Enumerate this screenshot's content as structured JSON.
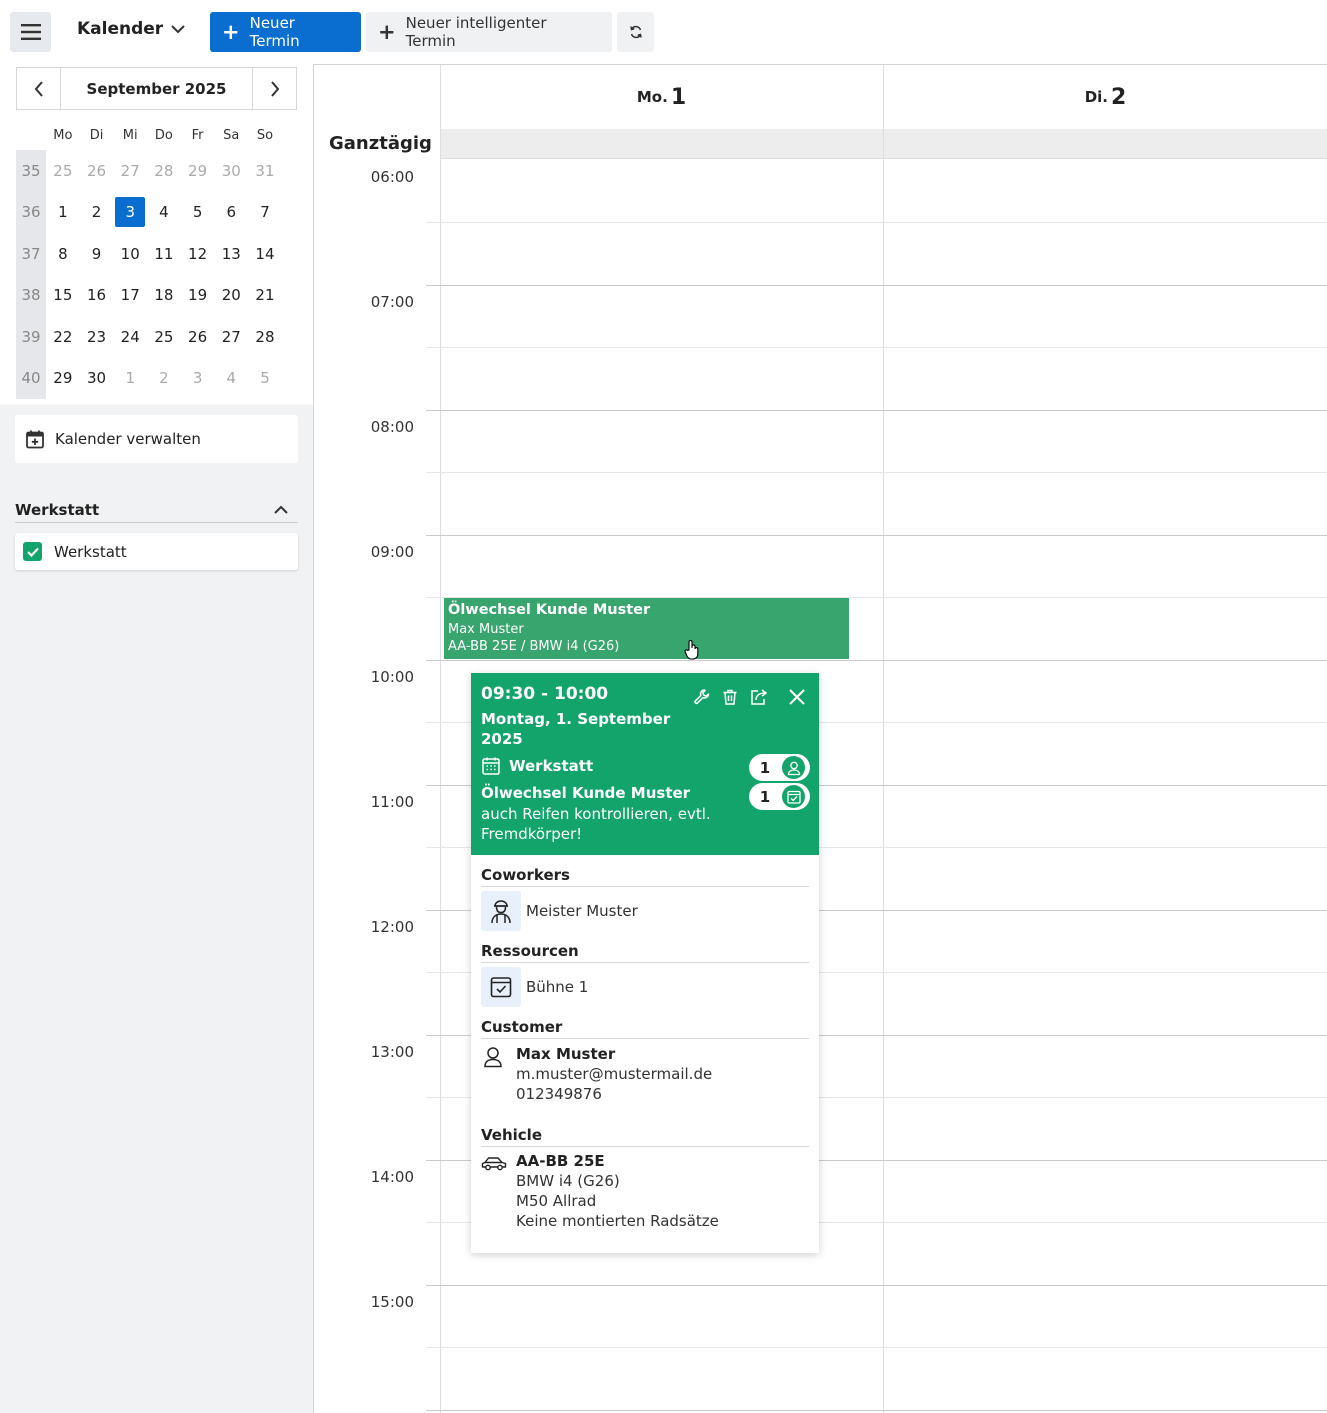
{
  "topbar": {
    "calendar_title": "Kalender",
    "new_appointment": "Neuer Termin",
    "new_smart_appointment": "Neuer intelligenter Termin"
  },
  "mini_calendar": {
    "month": "September 2025",
    "weekdays": [
      "Mo",
      "Di",
      "Mi",
      "Do",
      "Fr",
      "Sa",
      "So"
    ],
    "weeks": [
      {
        "wk": "35",
        "days": [
          "25",
          "26",
          "27",
          "28",
          "29",
          "30",
          "31"
        ],
        "muted": [
          1,
          1,
          1,
          1,
          1,
          1,
          1
        ]
      },
      {
        "wk": "36",
        "days": [
          "1",
          "2",
          "3",
          "4",
          "5",
          "6",
          "7"
        ],
        "muted": [
          0,
          0,
          0,
          0,
          0,
          0,
          0
        ]
      },
      {
        "wk": "37",
        "days": [
          "8",
          "9",
          "10",
          "11",
          "12",
          "13",
          "14"
        ],
        "muted": [
          0,
          0,
          0,
          0,
          0,
          0,
          0
        ]
      },
      {
        "wk": "38",
        "days": [
          "15",
          "16",
          "17",
          "18",
          "19",
          "20",
          "21"
        ],
        "muted": [
          0,
          0,
          0,
          0,
          0,
          0,
          0
        ]
      },
      {
        "wk": "39",
        "days": [
          "22",
          "23",
          "24",
          "25",
          "26",
          "27",
          "28"
        ],
        "muted": [
          0,
          0,
          0,
          0,
          0,
          0,
          0
        ]
      },
      {
        "wk": "40",
        "days": [
          "29",
          "30",
          "1",
          "2",
          "3",
          "4",
          "5"
        ],
        "muted": [
          0,
          0,
          1,
          1,
          1,
          1,
          1
        ]
      }
    ],
    "today": "3",
    "today_color": "#0a6ed1"
  },
  "sidebar": {
    "manage_calendars": "Kalender verwalten",
    "group_title": "Werkstatt",
    "calendar_item": "Werkstatt",
    "checkbox_color": "#12a46a"
  },
  "calendar": {
    "days": [
      {
        "dow": "Mo.",
        "num": "1"
      },
      {
        "dow": "Di.",
        "num": "2"
      }
    ],
    "all_day_label": "Ganztägig",
    "hours": [
      "06:00",
      "07:00",
      "08:00",
      "09:00",
      "10:00",
      "11:00",
      "12:00",
      "13:00",
      "14:00",
      "15:00"
    ]
  },
  "event": {
    "title": "Ölwechsel Kunde Muster",
    "customer": "Max Muster",
    "vehicle": "AA-BB 25E / BMW i4 (G26)",
    "color": "#38a46e"
  },
  "popup": {
    "time": "09:30 - 10:00",
    "date": "Montag, 1. September 2025",
    "calendar": "Werkstatt",
    "coworker_count": "1",
    "resource_count": "1",
    "title": "Ölwechsel Kunde Muster",
    "description": "auch Reifen kontrollieren, evtl. Fremdkörper!",
    "header_color": "#12a46a",
    "coworkers_heading": "Coworkers",
    "coworker": "Meister Muster",
    "resources_heading": "Ressourcen",
    "resource": "Bühne 1",
    "customer_heading": "Customer",
    "customer_name": "Max Muster",
    "customer_email": "m.muster@mustermail.de",
    "customer_phone": "012349876",
    "vehicle_heading": "Vehicle",
    "vehicle_plate": "AA-BB 25E",
    "vehicle_model": "BMW i4 (G26)",
    "vehicle_variant": "M50 Allrad",
    "vehicle_wheels": "Keine montierten Radsätze"
  }
}
